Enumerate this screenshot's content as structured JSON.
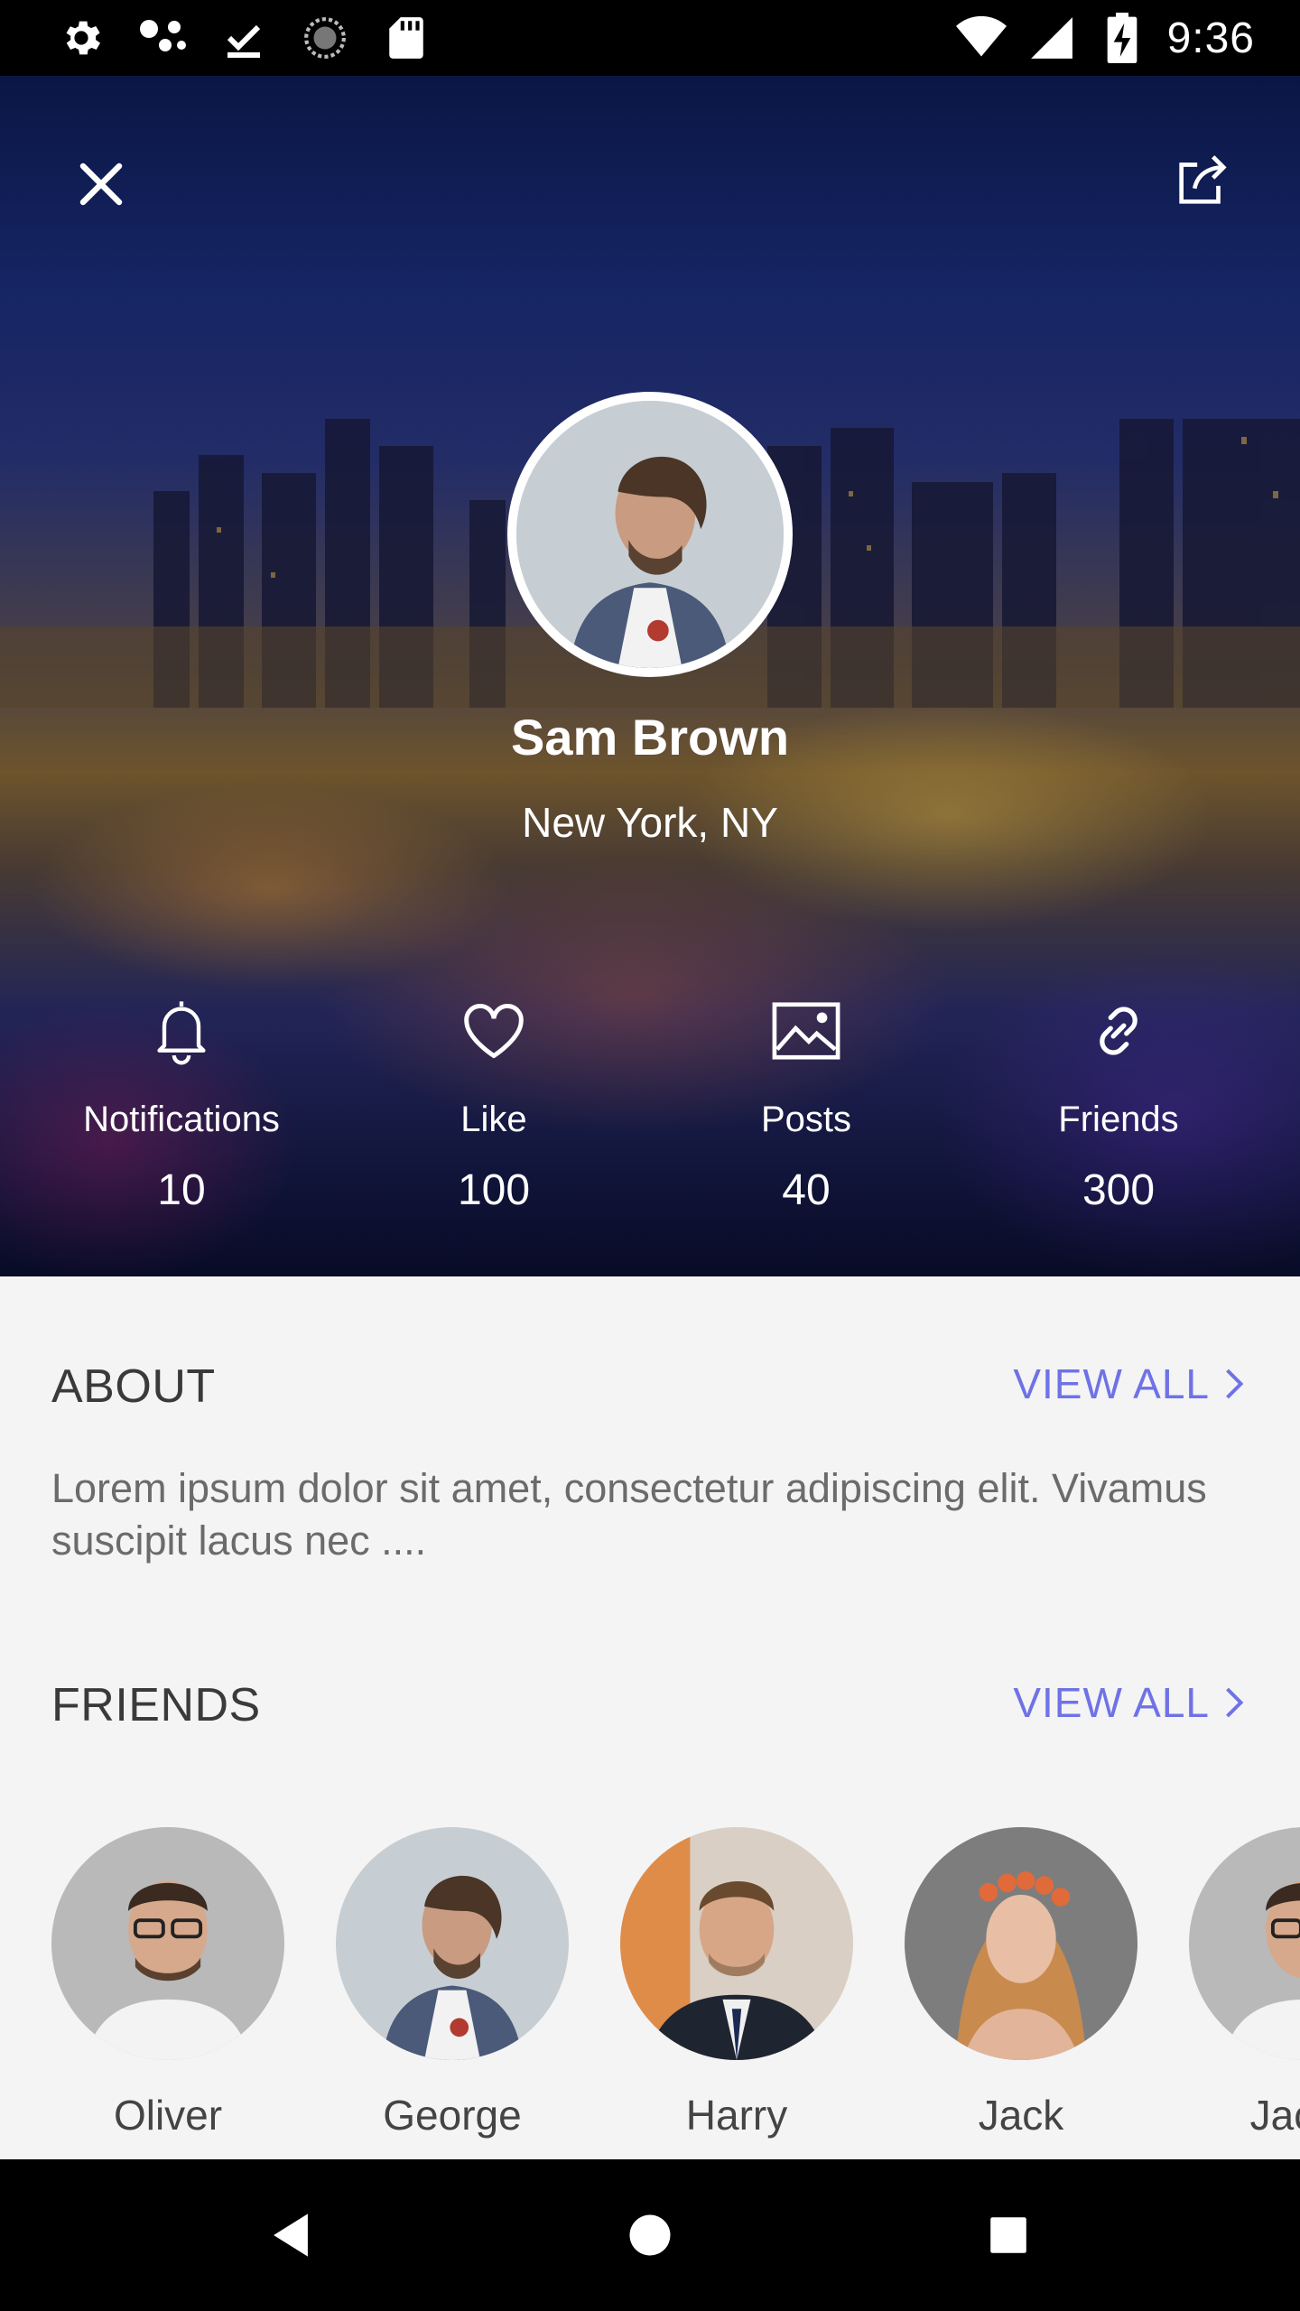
{
  "status_bar": {
    "time": "9:36",
    "left_icons": [
      "settings-icon",
      "cluster-icon",
      "download-done-icon",
      "sync-icon",
      "sd-card-icon"
    ],
    "right_icons": [
      "wifi-icon",
      "signal-icon",
      "battery-charging-icon"
    ]
  },
  "hero": {
    "name": "Sam Brown",
    "location": "New York, NY",
    "close_icon": "close-icon",
    "share_icon": "share-icon",
    "stats": [
      {
        "icon": "bell-icon",
        "label": "Notifications",
        "value": "10"
      },
      {
        "icon": "heart-icon",
        "label": "Like",
        "value": "100"
      },
      {
        "icon": "image-icon",
        "label": "Posts",
        "value": "40"
      },
      {
        "icon": "link-icon",
        "label": "Friends",
        "value": "300"
      }
    ]
  },
  "about": {
    "title": "ABOUT",
    "view_all": "VIEW ALL",
    "text": "Lorem ipsum dolor sit amet, consectetur adipiscing elit. Vivamus suscipit lacus nec ...."
  },
  "friends": {
    "title": "FRIENDS",
    "view_all": "VIEW ALL",
    "items": [
      {
        "name": "Oliver"
      },
      {
        "name": "George"
      },
      {
        "name": "Harry"
      },
      {
        "name": "Jack"
      },
      {
        "name": "Jacob"
      }
    ]
  },
  "colors": {
    "accent": "#6f72e6",
    "background": "#f4f4f4",
    "title_text": "#3a3a3a",
    "body_text": "#6b6b6b"
  },
  "nav_bar": {
    "buttons": [
      "back-icon",
      "home-icon",
      "recents-icon"
    ]
  }
}
